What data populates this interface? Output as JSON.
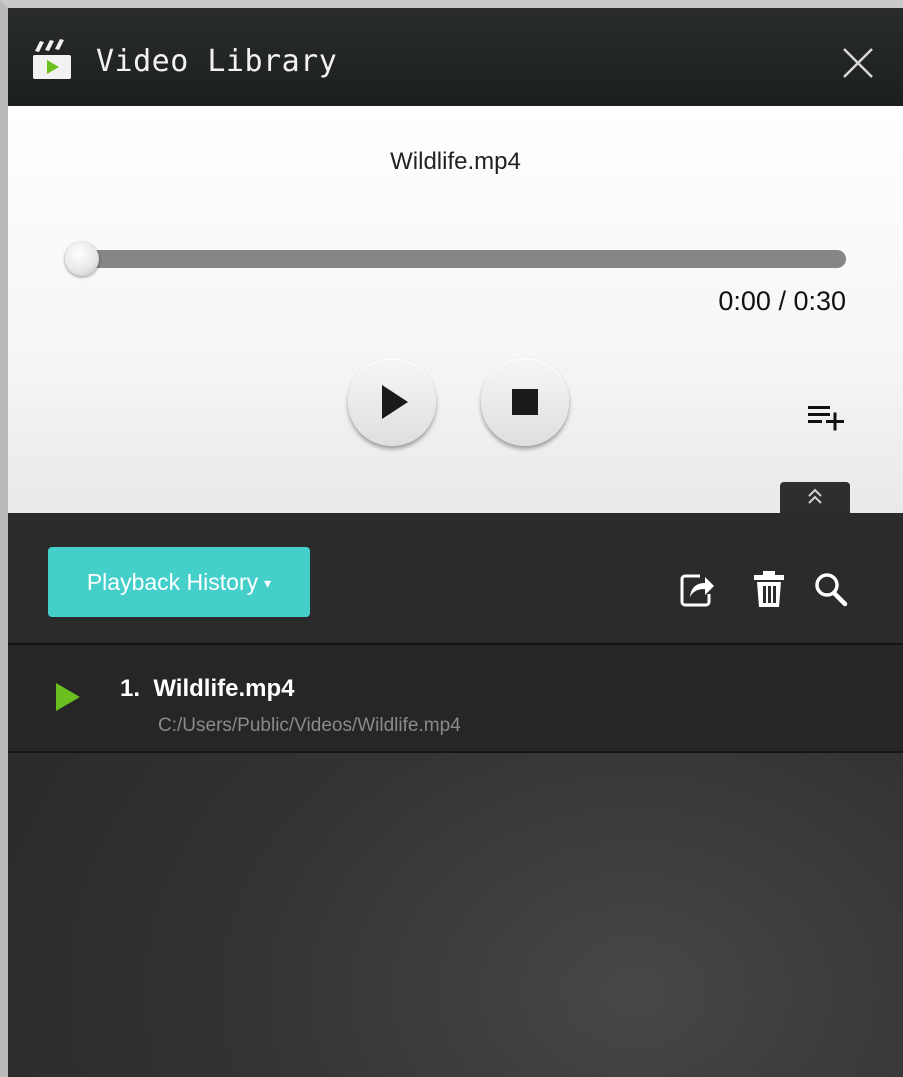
{
  "window": {
    "title": "Video Library",
    "icon": "clapperboard-icon",
    "close_icon": "close-icon"
  },
  "player": {
    "now_playing": "Wildlife.mp4",
    "progress": 0,
    "time_display": "0:00 / 0:30",
    "play_icon": "play-icon",
    "stop_icon": "stop-icon",
    "queue_add_icon": "playlist-add-icon",
    "collapse_icon": "chevron-double-up-icon"
  },
  "library": {
    "view_button_label": "Playback History",
    "view_button_caret": "▾",
    "tools": [
      "share-icon",
      "trash-icon",
      "search-icon"
    ],
    "items": [
      {
        "number": "1.",
        "title": "Wildlife.mp4",
        "path": "C:/Users/Public/Videos/Wildlife.mp4"
      }
    ]
  },
  "colors": {
    "accent": "#45cfca",
    "play_marker": "#6bbf1f",
    "titlebar": "#1f2222"
  }
}
